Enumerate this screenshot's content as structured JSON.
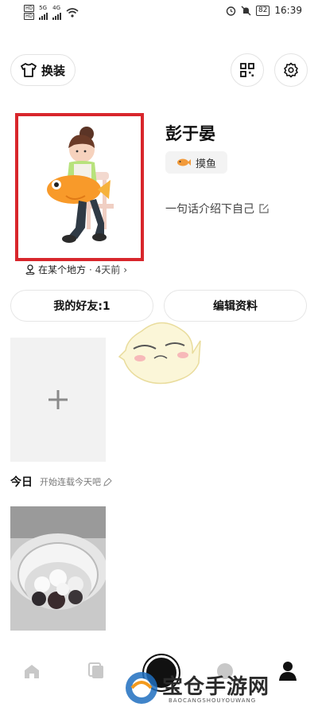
{
  "status_bar": {
    "hd_top": "HD",
    "hd_bottom": "HD",
    "signal_a": "5G",
    "signal_b": "4G",
    "battery": "82",
    "time": "16:39"
  },
  "header": {
    "outfit_label": "换装",
    "icons": [
      "tshirt-icon",
      "qr-code-icon",
      "gear-icon"
    ]
  },
  "profile": {
    "name": "彭于晏",
    "status_label": "摸鱼",
    "bio": "一句话介绍下自己",
    "location": "在某个地方",
    "location_time": "· 4天前"
  },
  "actions": {
    "friends_label": "我的好友:1",
    "edit_label": "编辑资料"
  },
  "feed": {
    "today_label": "今日",
    "streak_text": "开始连载今天吧"
  },
  "watermark": {
    "text": "宝仓手游网",
    "sub": "BAOCANGSHOUYOUWANG"
  },
  "colors": {
    "highlight": "#d8262c",
    "tile_bg": "#f2f2f2"
  }
}
